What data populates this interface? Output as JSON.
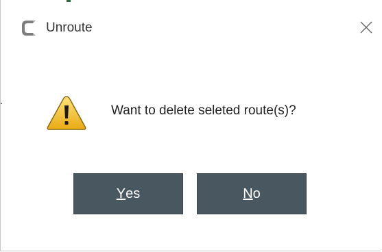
{
  "window": {
    "title": "Unroute",
    "app_icon": "app-logo-icon",
    "close_icon": "close-icon"
  },
  "dialog": {
    "icon": "warning-icon",
    "message": "Want to delete seleted route(s)?"
  },
  "buttons": {
    "yes": {
      "mnemonic": "Y",
      "rest": "es"
    },
    "no": {
      "mnemonic": "N",
      "rest": "o"
    }
  },
  "colors": {
    "button_bg": "#485760",
    "button_text": "#ffffff",
    "warning_fill": "#f2c233",
    "warning_outline": "#8a6a12"
  }
}
